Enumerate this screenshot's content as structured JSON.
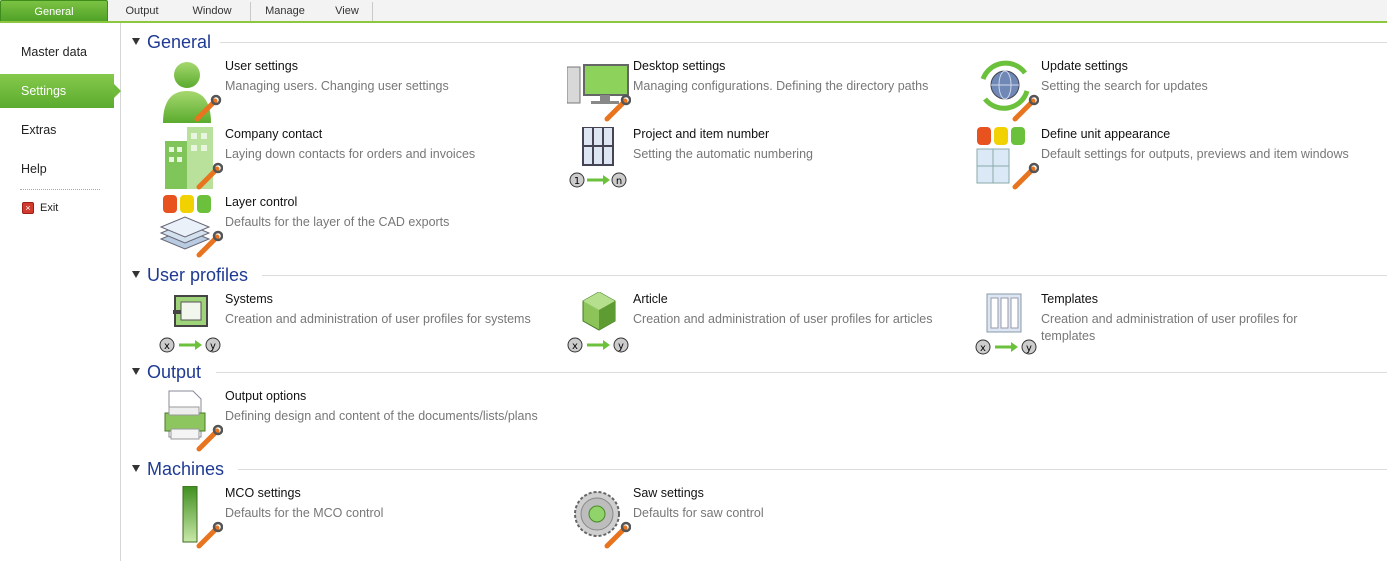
{
  "tabs": [
    "General",
    "Output",
    "Window",
    "Manage",
    "View"
  ],
  "sidebar": {
    "items": [
      "Master data",
      "Settings",
      "Extras",
      "Help"
    ],
    "exit_label": "Exit"
  },
  "sections": {
    "general": {
      "title": "General",
      "items": [
        {
          "name": "User settings",
          "desc": "Managing users. Changing user settings",
          "icon": "user-icon"
        },
        {
          "name": "Desktop settings",
          "desc": "Managing configurations. Defining the directory paths",
          "icon": "desktop-icon"
        },
        {
          "name": "Update settings",
          "desc": "Setting the search for updates",
          "icon": "globe-refresh-icon"
        },
        {
          "name": "Company contact",
          "desc": "Laying down contacts for orders and invoices",
          "icon": "building-icon"
        },
        {
          "name": "Project and item number",
          "desc": "Setting the automatic numbering",
          "icon": "numbering-icon"
        },
        {
          "name": "Define unit appearance",
          "desc": "Default settings for outputs, previews and item windows",
          "icon": "unit-appearance-icon"
        },
        {
          "name": "Layer control",
          "desc": "Defaults for the layer of the CAD exports",
          "icon": "layers-icon"
        }
      ]
    },
    "user_profiles": {
      "title": "User profiles",
      "items": [
        {
          "name": "Systems",
          "desc": "Creation and administration of user profiles for systems",
          "icon": "systems-icon"
        },
        {
          "name": "Article",
          "desc": "Creation and administration of user profiles for articles",
          "icon": "cube-icon"
        },
        {
          "name": "Templates",
          "desc": "Creation and administration of user profiles for templates",
          "icon": "templates-icon"
        }
      ]
    },
    "output": {
      "title": "Output",
      "items": [
        {
          "name": "Output options",
          "desc": "Defining design and content of the documents/lists/plans",
          "icon": "printer-icon"
        }
      ]
    },
    "machines": {
      "title": "Machines",
      "items": [
        {
          "name": "MCO settings",
          "desc": "Defaults for the MCO control",
          "icon": "mco-icon"
        },
        {
          "name": "Saw settings",
          "desc": "Defaults for saw control",
          "icon": "saw-blade-icon"
        }
      ]
    }
  },
  "colors": {
    "accent": "#5aab2e",
    "section_title": "#1f3a93",
    "desc_text": "#777777"
  }
}
